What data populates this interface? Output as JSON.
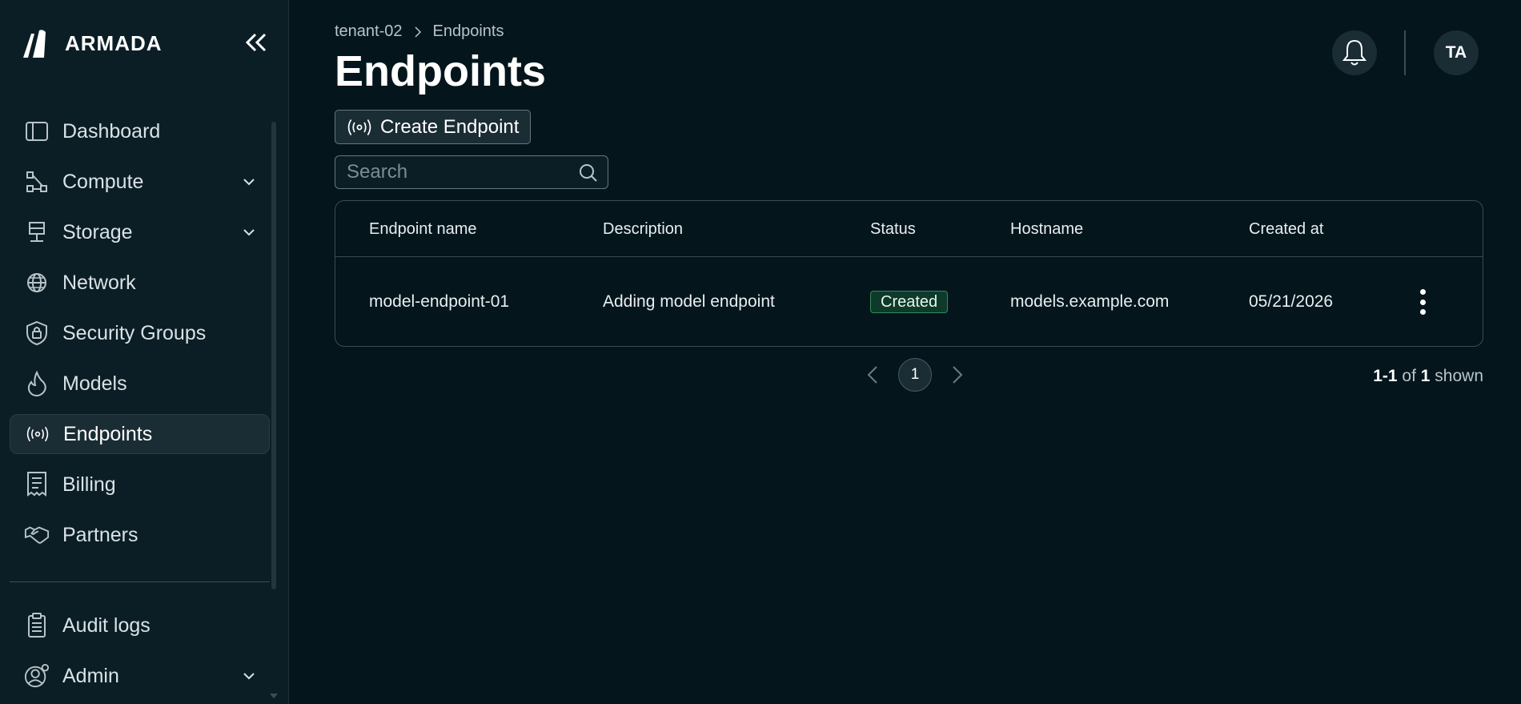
{
  "brand": {
    "name": "ARMADA"
  },
  "sidebar": {
    "items": [
      {
        "label": "Dashboard",
        "icon": "dashboard-icon",
        "expandable": false
      },
      {
        "label": "Compute",
        "icon": "compute-icon",
        "expandable": true
      },
      {
        "label": "Storage",
        "icon": "storage-icon",
        "expandable": true
      },
      {
        "label": "Network",
        "icon": "globe-icon",
        "expandable": false
      },
      {
        "label": "Security Groups",
        "icon": "shield-lock-icon",
        "expandable": false
      },
      {
        "label": "Models",
        "icon": "flame-icon",
        "expandable": false
      },
      {
        "label": "Endpoints",
        "icon": "broadcast-icon",
        "expandable": false,
        "active": true
      },
      {
        "label": "Billing",
        "icon": "receipt-icon",
        "expandable": false
      },
      {
        "label": "Partners",
        "icon": "handshake-icon",
        "expandable": false
      }
    ],
    "bottom_items": [
      {
        "label": "Audit logs",
        "icon": "clipboard-icon",
        "expandable": false
      },
      {
        "label": "Admin",
        "icon": "user-gear-icon",
        "expandable": true
      }
    ]
  },
  "breadcrumb": {
    "tenant": "tenant-02",
    "current": "Endpoints"
  },
  "page": {
    "title": "Endpoints"
  },
  "toolbar": {
    "create_label": "Create Endpoint"
  },
  "search": {
    "placeholder": "Search",
    "value": ""
  },
  "table": {
    "columns": [
      "Endpoint name",
      "Description",
      "Status",
      "Hostname",
      "Created at"
    ],
    "rows": [
      {
        "name": "model-endpoint-01",
        "description": "Adding model endpoint",
        "status": "Created",
        "hostname": "models.example.com",
        "created_at": "05/21/2026"
      }
    ]
  },
  "pagination": {
    "current_page": "1",
    "range": "1-1",
    "of_word": "of",
    "total": "1",
    "shown_word": "shown"
  },
  "user": {
    "initials": "TA"
  },
  "colors": {
    "background": "#04151c",
    "sidebar": "#0b1e26",
    "status_created_bg": "#0d3a2a",
    "status_created_border": "#2f8a5a"
  }
}
